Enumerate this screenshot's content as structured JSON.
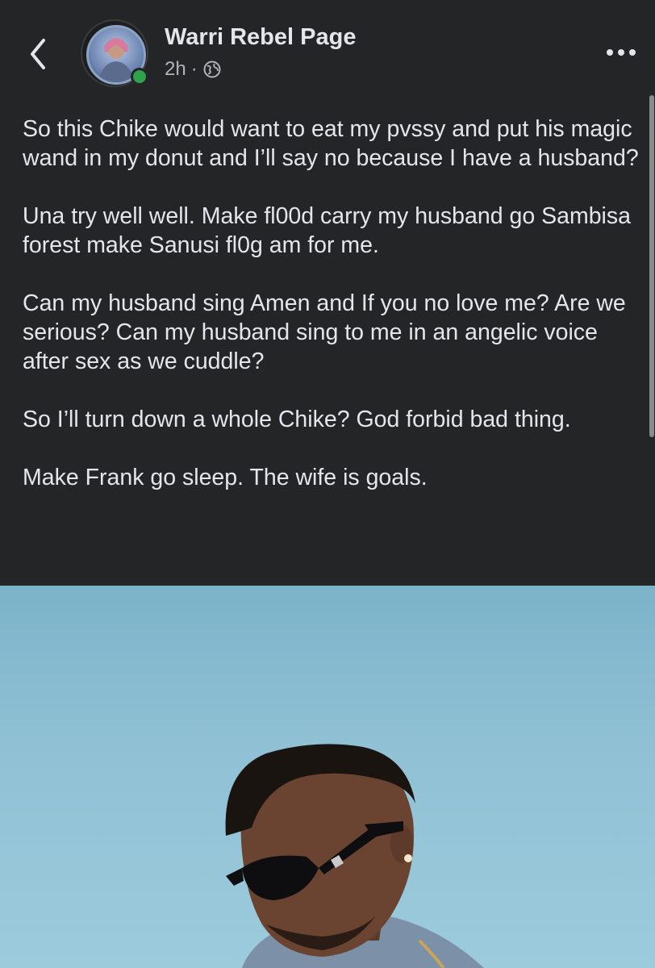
{
  "header": {
    "page_name": "Warri Rebel Page",
    "time": "2h",
    "separator": "·",
    "audience_icon": "globe-icon",
    "back_icon": "chevron-left-icon",
    "more_icon": "more-horizontal-icon"
  },
  "post": {
    "paragraphs": [
      "So this Chike would want to eat my pvssy and put his magic wand in my donut and I’ll say no because I have a husband?",
      "Una try well well. Make fl00d carry my husband go Sambisa forest make Sanusi fl0g am for me.",
      "Can my husband sing Amen and If you no love me? Are we serious? Can my husband sing to me in an angelic voice after sex as we cuddle?",
      "So I’ll turn down a whole Chike? God forbid bad thing.",
      "Make Frank go sleep. The wife is goals."
    ]
  },
  "colors": {
    "background": "#242527",
    "text": "#e4e6eb",
    "secondary_text": "#b0b3b8",
    "online": "#31a24c",
    "photo_sky": "#8fc0d4"
  }
}
